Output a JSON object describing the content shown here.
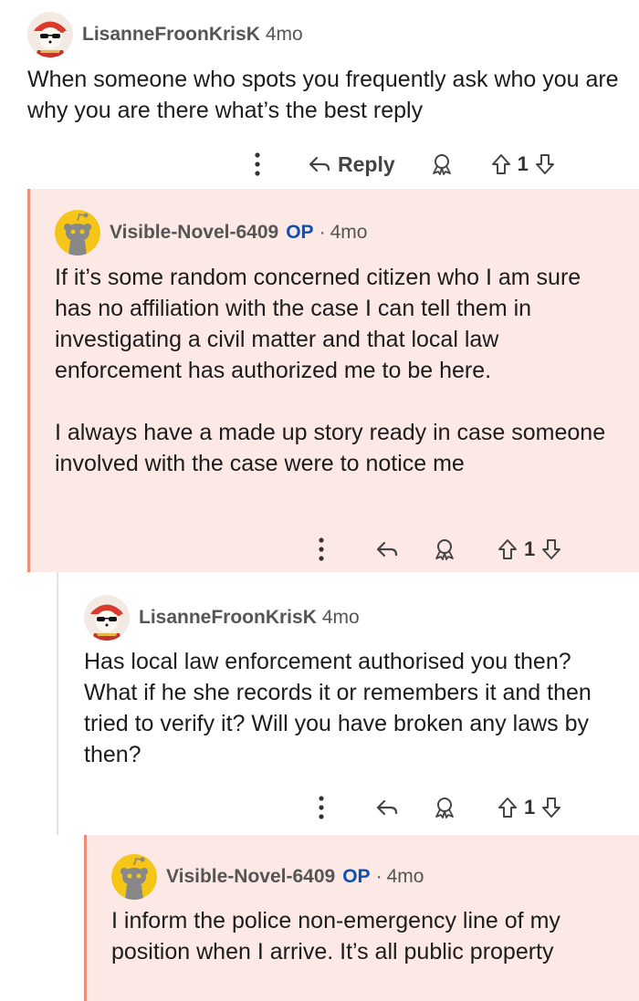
{
  "comments": [
    {
      "username": "LisanneFroonKrisK",
      "op_badge": "",
      "separator": "",
      "time": "4mo",
      "paragraphs": [
        "When someone who spots you frequently ask who you are why you are there what’s the best reply"
      ],
      "reply_label": "Reply",
      "votes": "1",
      "avatar": "bear-avatar"
    },
    {
      "username": "Visible-Novel-6409",
      "op_badge": "OP",
      "separator": "·",
      "time": "4mo",
      "paragraphs": [
        "If it’s some random concerned citizen who I am sure has no affiliation with the case I can tell them in investigating a civil matter and that local law enforcement has authorized me to be here.",
        "I always have a made up story ready in case someone involved with the case were to notice me"
      ],
      "votes": "1",
      "avatar": "snoo-avatar"
    },
    {
      "username": "LisanneFroonKrisK",
      "op_badge": "",
      "separator": "",
      "time": "4mo",
      "paragraphs": [
        "Has local law enforcement authorised you then? What if he she records it or remembers it and then tried to verify it? Will you have broken any laws by then?"
      ],
      "votes": "1",
      "avatar": "bear-avatar"
    },
    {
      "username": "Visible-Novel-6409",
      "op_badge": "OP",
      "separator": "·",
      "time": "4mo",
      "paragraphs": [
        "I inform the police non-emergency line of my position when I arrive. It’s all public property"
      ],
      "avatar": "snoo-avatar"
    }
  ],
  "colors": {
    "highlight_bg": "#fce9e6",
    "highlight_bar": "#f08b74",
    "op_badge": "#0f4fb3"
  }
}
